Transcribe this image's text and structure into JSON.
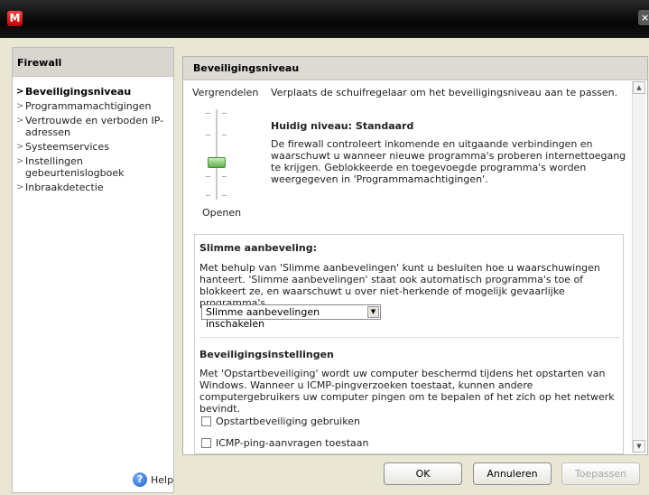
{
  "titlebar": {
    "logo_letter": "M",
    "close_glyph": "×"
  },
  "sidebar": {
    "title": "Firewall",
    "items": [
      {
        "label": "Beveiligingsniveau",
        "active": true
      },
      {
        "label": "Programmamachtigingen"
      },
      {
        "label": "Vertrouwde en verboden IP-adressen"
      },
      {
        "label": "Systeemservices"
      },
      {
        "label": "Instellingen gebeurtenislogboek"
      },
      {
        "label": "Inbraakdetectie"
      }
    ],
    "help_label": "Help"
  },
  "main": {
    "title": "Beveiligingsniveau",
    "lock_label": "Vergrendelen",
    "open_label": "Openen",
    "instruction": "Verplaats de schuifregelaar om het beveiligingsniveau aan te passen.",
    "current_level_label": "Huidig niveau:",
    "current_level_value": "Standaard",
    "description": "De firewall controleert inkomende en uitgaande verbindingen en waarschuwt u wanneer nieuwe programma's proberen internettoegang te krijgen. Geblokkeerde en toegevoegde programma's worden weergegeven in 'Programmamachtigingen'.",
    "slider_level": "Standaard",
    "smart": {
      "title": "Slimme aanbeveling:",
      "text": "Met behulp van 'Slimme aanbevelingen' kunt u besluiten hoe u waarschuwingen hanteert. 'Slimme aanbevelingen' staat ook automatisch programma's toe of blokkeert ze, en waarschuwt u over niet-herkende of mogelijk gevaarlijke programma's.",
      "dropdown_value": "Slimme aanbevelingen inschakelen"
    },
    "security": {
      "title": "Beveiligingsinstellingen",
      "text": "Met 'Opstartbeveiliging' wordt uw computer beschermd tijdens het opstarten van Windows. Wanneer u ICMP-pingverzoeken toestaat, kunnen andere computergebruikers uw computer pingen om te bepalen of het zich op het netwerk bevindt.",
      "checkbox1": {
        "label": "Opstartbeveiliging gebruiken",
        "checked": false
      },
      "checkbox2": {
        "label": "ICMP-ping-aanvragen toestaan",
        "checked": false
      }
    }
  },
  "buttons": {
    "ok": "OK",
    "cancel": "Annuleren",
    "apply": "Toepassen"
  },
  "colors": {
    "titlebar": "#0b0b0b",
    "window_bg": "#e9e6d3",
    "header_bg": "#dcdad3",
    "slider_thumb": "#5eb04a"
  }
}
